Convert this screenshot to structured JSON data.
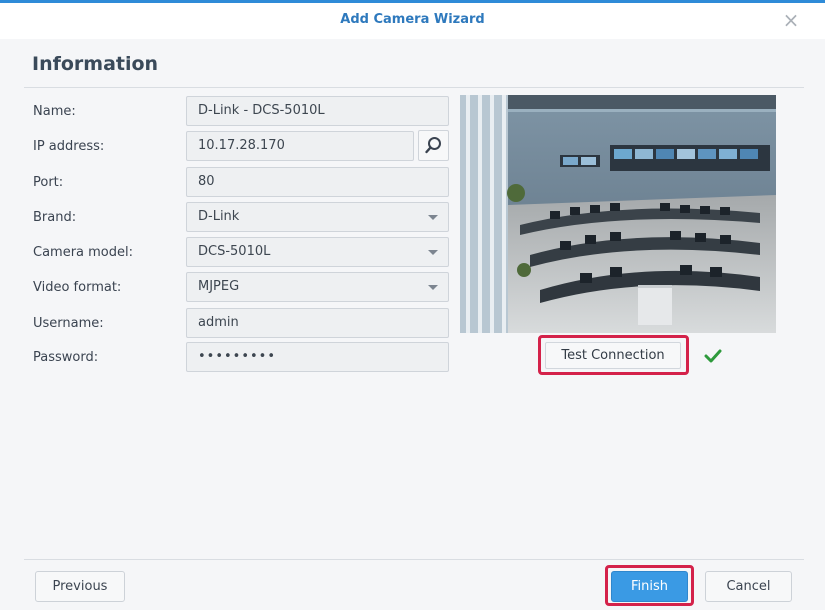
{
  "dialog": {
    "title": "Add Camera Wizard",
    "close_glyph": "×",
    "section_heading": "Information"
  },
  "form": {
    "fields": [
      {
        "label": "Name:",
        "value": "D-Link - DCS-5010L",
        "type": "text"
      },
      {
        "label": "IP address:",
        "value": "10.17.28.170",
        "type": "text"
      },
      {
        "label": "Port:",
        "value": "80",
        "type": "text"
      },
      {
        "label": "Brand:",
        "value": "D-Link",
        "type": "select"
      },
      {
        "label": "Camera model:",
        "value": "DCS-5010L",
        "type": "select"
      },
      {
        "label": "Video format:",
        "value": "MJPEG",
        "type": "select"
      },
      {
        "label": "Username:",
        "value": "admin",
        "type": "text"
      },
      {
        "label": "Password:",
        "value": "•••••••••",
        "type": "password"
      }
    ]
  },
  "preview": {
    "test_connection_label": "Test Connection",
    "connection_status_icon": "check-icon",
    "status_color": "#2e9a3c"
  },
  "footer": {
    "previous_label": "Previous",
    "finish_label": "Finish",
    "cancel_label": "Cancel"
  },
  "colors": {
    "accent": "#3a9ae4",
    "title": "#2e79bd",
    "highlight": "#d4224a"
  },
  "icons": {
    "search": "search-icon",
    "close": "close-icon",
    "dropdown": "chevron-down-icon"
  }
}
